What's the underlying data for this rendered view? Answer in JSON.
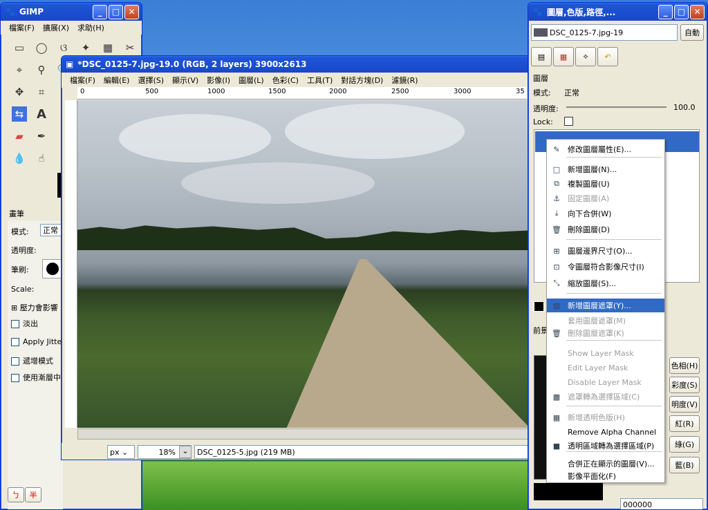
{
  "toolbox": {
    "title": "GIMP",
    "menu": [
      "檔案(F)",
      "擴展(X)",
      "求助(H)"
    ],
    "brush_section": "畫筆",
    "mode_label": "模式:",
    "mode_value": "正常",
    "opacity_label": "透明度:",
    "brush_label": "筆刷:",
    "scale_label": "Scale:",
    "pressure_label": "壓力會影響",
    "fade_label": "淡出",
    "jitter_label": "Apply Jitte",
    "incremental_label": "遞增模式",
    "use_color_label": "使用漸層中",
    "ime_btn1": "ㄅ",
    "ime_btn2": "半"
  },
  "image_window": {
    "title": "*DSC_0125-7.jpg-19.0 (RGB, 2 layers) 3900x2613",
    "menu": [
      "檔案(F)",
      "編輯(E)",
      "選擇(S)",
      "顯示(V)",
      "影像(I)",
      "圖層(L)",
      "色彩(C)",
      "工具(T)",
      "對話方塊(D)",
      "濾鏡(R)"
    ],
    "ruler_ticks": [
      "0",
      "500",
      "1000",
      "1500",
      "2000",
      "2500",
      "3000",
      "35"
    ],
    "unit": "px",
    "zoom": "18%",
    "status": "DSC_0125-5.jpg (219 MB)"
  },
  "layers_dialog": {
    "title": "圖層,色版,路徑,...",
    "image_selector": "DSC_0125-7.jpg-19",
    "auto_button": "自動",
    "section_label": "圖層",
    "mode_label": "模式:",
    "mode_value": "正常",
    "opacity_label": "透明度:",
    "opacity_value": "100.0",
    "lock_label": "Lock:",
    "fg_label": "前景",
    "hex_value": "000000",
    "color_buttons": [
      "色相(H)",
      "彩度(S)",
      "明度(V)",
      "紅(R)",
      "綠(G)",
      "藍(B)"
    ]
  },
  "context_menu": {
    "items": [
      {
        "label": "修改圖層屬性(E)...",
        "icon": "edit-icon",
        "disabled": false
      },
      {
        "label": "新增圖層(N)...",
        "icon": "new-layer-icon",
        "disabled": false
      },
      {
        "label": "複製圖層(U)",
        "icon": "duplicate-icon",
        "disabled": false
      },
      {
        "label": "固定圖層(A)",
        "icon": "anchor-icon",
        "disabled": true
      },
      {
        "label": "向下合併(W)",
        "icon": "merge-down-icon",
        "disabled": false
      },
      {
        "label": "刪除圖層(D)",
        "icon": "trash-icon",
        "disabled": false
      },
      {
        "label": "圖層邊界尺寸(O)...",
        "icon": "boundary-icon",
        "disabled": false
      },
      {
        "label": "令圖層符合影像尺寸(I)",
        "icon": "fit-icon",
        "disabled": false
      },
      {
        "label": "縮放圖層(S)...",
        "icon": "scale-icon",
        "disabled": false
      },
      {
        "label": "新增圖層遮罩(Y)...",
        "icon": "mask-icon",
        "disabled": false,
        "selected": true
      },
      {
        "label": "套用圖層遮罩(M)",
        "icon": "",
        "disabled": true
      },
      {
        "label": "刪除圖層遮罩(K)",
        "icon": "trash-icon",
        "disabled": true
      },
      {
        "label": "Show Layer Mask",
        "icon": "",
        "disabled": true
      },
      {
        "label": "Edit Layer Mask",
        "icon": "",
        "disabled": true
      },
      {
        "label": "Disable Layer Mask",
        "icon": "",
        "disabled": true
      },
      {
        "label": "遮罩轉為選擇區域(C)",
        "icon": "mask-select-icon",
        "disabled": true
      },
      {
        "label": "新增透明色版(H)",
        "icon": "alpha-icon",
        "disabled": true
      },
      {
        "label": "Remove Alpha Channel",
        "icon": "",
        "disabled": false
      },
      {
        "label": "透明區域轉為選擇區域(P)",
        "icon": "alpha-select-icon",
        "disabled": false
      },
      {
        "label": "合併正在顯示的圖層(V)...",
        "icon": "",
        "disabled": false
      },
      {
        "label": "影像平面化(F)",
        "icon": "",
        "disabled": false
      }
    ]
  }
}
